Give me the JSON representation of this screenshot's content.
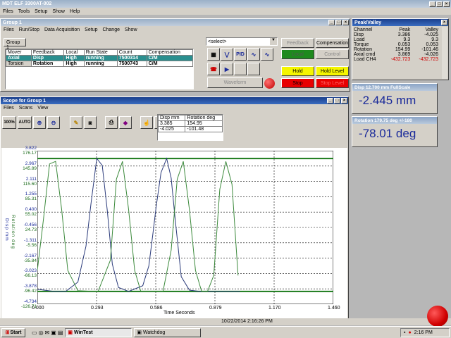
{
  "main": {
    "title": "MDT ELF 3300AT-002",
    "menu": [
      "Files",
      "Tools",
      "Setup",
      "Show",
      "Help"
    ]
  },
  "group": {
    "title": "Group 1",
    "menu": [
      "Files",
      "Run/Stop",
      "Data Acquisition",
      "Setup",
      "Change",
      "Show"
    ],
    "tab": "Group 1",
    "columns": [
      "Mover",
      "Feedback",
      "Local",
      "Run State",
      "Count",
      "Compensation"
    ],
    "rows": [
      [
        "Axial",
        "Disp",
        "High",
        "running",
        "7500314",
        "C/M"
      ],
      [
        "Torsion",
        "Rotation",
        "High",
        "running",
        "7500743",
        "C/M"
      ]
    ],
    "select": "<select>",
    "waveform": "Waveform",
    "buttons": {
      "feedback": "Feedback",
      "compensation": "Compensation",
      "local": "Local",
      "control": "Control",
      "hold": "Hold",
      "hold_level": "Hold Level",
      "stop": "Stop",
      "stop_level": "Stop Level"
    }
  },
  "peak": {
    "title": "Peak/Valley",
    "headers": [
      "Channel",
      "Peak",
      "Valley"
    ],
    "rows": [
      [
        "Disp",
        "3.386",
        "-4.025"
      ],
      [
        "Load",
        "9.3",
        "9.3"
      ],
      [
        "Torque",
        "0.053",
        "0.053"
      ],
      [
        "Rotation",
        "154.99",
        "-101.46"
      ],
      [
        "Axial cmd",
        "3.869",
        "-4.026"
      ],
      [
        "Load CH4",
        "-432.723",
        "-432.723"
      ]
    ]
  },
  "disp": {
    "title": "Disp 12.700 mm FullScale",
    "value": "-2.445 mm"
  },
  "rot": {
    "title": "Rotation 179.75 deg +/-180",
    "value": "-78.01 deg"
  },
  "scope": {
    "title": "Scope for Group 1",
    "menu": [
      "Files",
      "Scans",
      "View"
    ],
    "btn100": "100%",
    "btnauto": "AUTO",
    "readout": {
      "headers": [
        "Disp mm",
        "Rotation deg"
      ],
      "rows": [
        [
          "3.385",
          "154.95"
        ],
        [
          "-4.025",
          "-101.48"
        ]
      ]
    },
    "ylabel_disp": "Disp mm",
    "ylabel_rot": "Rotation deg",
    "xlabel": "Time Seconds",
    "timestamp": "10/22/2014 2:16:26 PM"
  },
  "chart_data": {
    "type": "line",
    "xlabel": "Time Seconds",
    "xlim": [
      0,
      1.46
    ],
    "x_ticks": [
      "0.000",
      "0.293",
      "0.586",
      "0.879",
      "1.170",
      "1.460"
    ],
    "y_ticks_disp": [
      "3.822",
      "2.967",
      "2.111",
      "1.255",
      "0.400",
      "-0.456",
      "-1.311",
      "-2.167",
      "-3.023",
      "-3.878",
      "-4.734"
    ],
    "y_ticks_rot": [
      "176.17",
      "145.89",
      "115.60",
      "85.31",
      "55.02",
      "24.73",
      "-5.56",
      "-35.84",
      "-66.13",
      "-96.42",
      "-126.71"
    ],
    "ylim_disp": [
      -4.734,
      3.822
    ],
    "limit_lines": [
      3.386,
      -4.025
    ],
    "series": [
      {
        "name": "Disp mm",
        "color": "#2a3a7a",
        "x": [
          0,
          0.08,
          0.14,
          0.2,
          0.24,
          0.265,
          0.293,
          0.32,
          0.345,
          0.37,
          0.4,
          0.45,
          0.52,
          0.55,
          0.57,
          0.586,
          0.61,
          0.638,
          0.66,
          0.68,
          0.71,
          0.75,
          0.8,
          0.85,
          0.9,
          0.95,
          1.0
        ],
        "y": [
          -3.9,
          -4.02,
          -4.02,
          -3.5,
          -1.5,
          0.9,
          3.39,
          3.0,
          0.5,
          -2.5,
          -3.8,
          -4.02,
          -3.7,
          -2.6,
          -0.8,
          0.7,
          2.6,
          3.39,
          2.3,
          0.0,
          -3.2,
          -3.95,
          -4.02,
          -4.02,
          -4.02,
          -4.02,
          -4.02
        ]
      },
      {
        "name": "Rotation deg",
        "color": "#3c8a3c",
        "x": [
          0,
          0.03,
          0.06,
          0.09,
          0.12,
          0.15,
          0.2,
          0.25,
          0.3,
          0.36,
          0.39,
          0.42,
          0.45,
          0.48,
          0.51,
          0.56,
          0.62,
          0.66,
          0.69,
          0.72,
          0.75,
          0.78,
          0.81,
          0.84,
          0.87,
          0.9,
          0.93,
          0.96,
          0.99
        ],
        "y": [
          -60,
          40,
          150,
          155,
          60,
          -60,
          -100,
          -101,
          -101,
          -40,
          120,
          155,
          60,
          -60,
          -101,
          -101,
          -101,
          -20,
          120,
          155,
          60,
          -60,
          -101,
          -101,
          -70,
          100,
          155,
          110,
          -70
        ]
      }
    ]
  },
  "taskbar": {
    "start": "Start",
    "items": [
      "WinTest",
      "Watchdog"
    ],
    "clock": "2:16 PM"
  }
}
